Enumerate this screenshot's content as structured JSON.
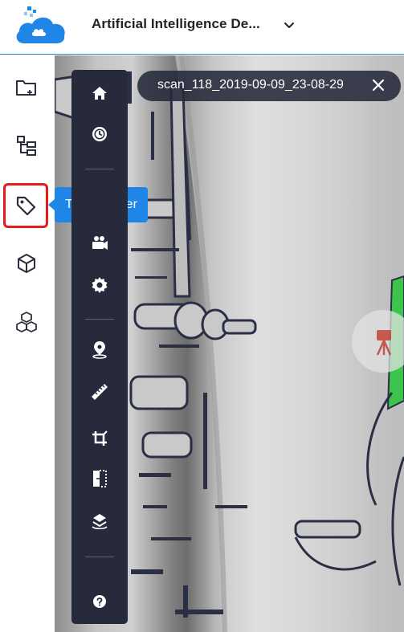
{
  "header": {
    "project_title": "Artificial Intelligence De...",
    "logo_icon": "cloud-logo-icon",
    "dropdown_icon": "chevron-down-icon"
  },
  "rail": {
    "items": [
      {
        "name": "folder-icon",
        "selected": false
      },
      {
        "name": "hierarchy-icon",
        "selected": false
      },
      {
        "name": "tag-icon",
        "selected": true
      },
      {
        "name": "cube-icon",
        "selected": false
      },
      {
        "name": "cubes-icon",
        "selected": false
      }
    ]
  },
  "tooltip": {
    "label": "Tag Explorer"
  },
  "scan_tab": {
    "label": "scan_118_2019-09-09_23-08-29",
    "close_icon": "close-icon"
  },
  "toolbar": {
    "items": [
      "home-icon",
      "clock-icon",
      "camera-icon",
      "settings-icon",
      "location-icon",
      "ruler-icon",
      "crop-icon",
      "compare-icon",
      "layers-icon",
      "help-icon"
    ]
  },
  "colors": {
    "accent": "#1f86e8",
    "toolbar_bg": "#262a3a",
    "selection": "#e61b1b",
    "marker": "#c0392b",
    "green_object": "#3cc54a"
  }
}
